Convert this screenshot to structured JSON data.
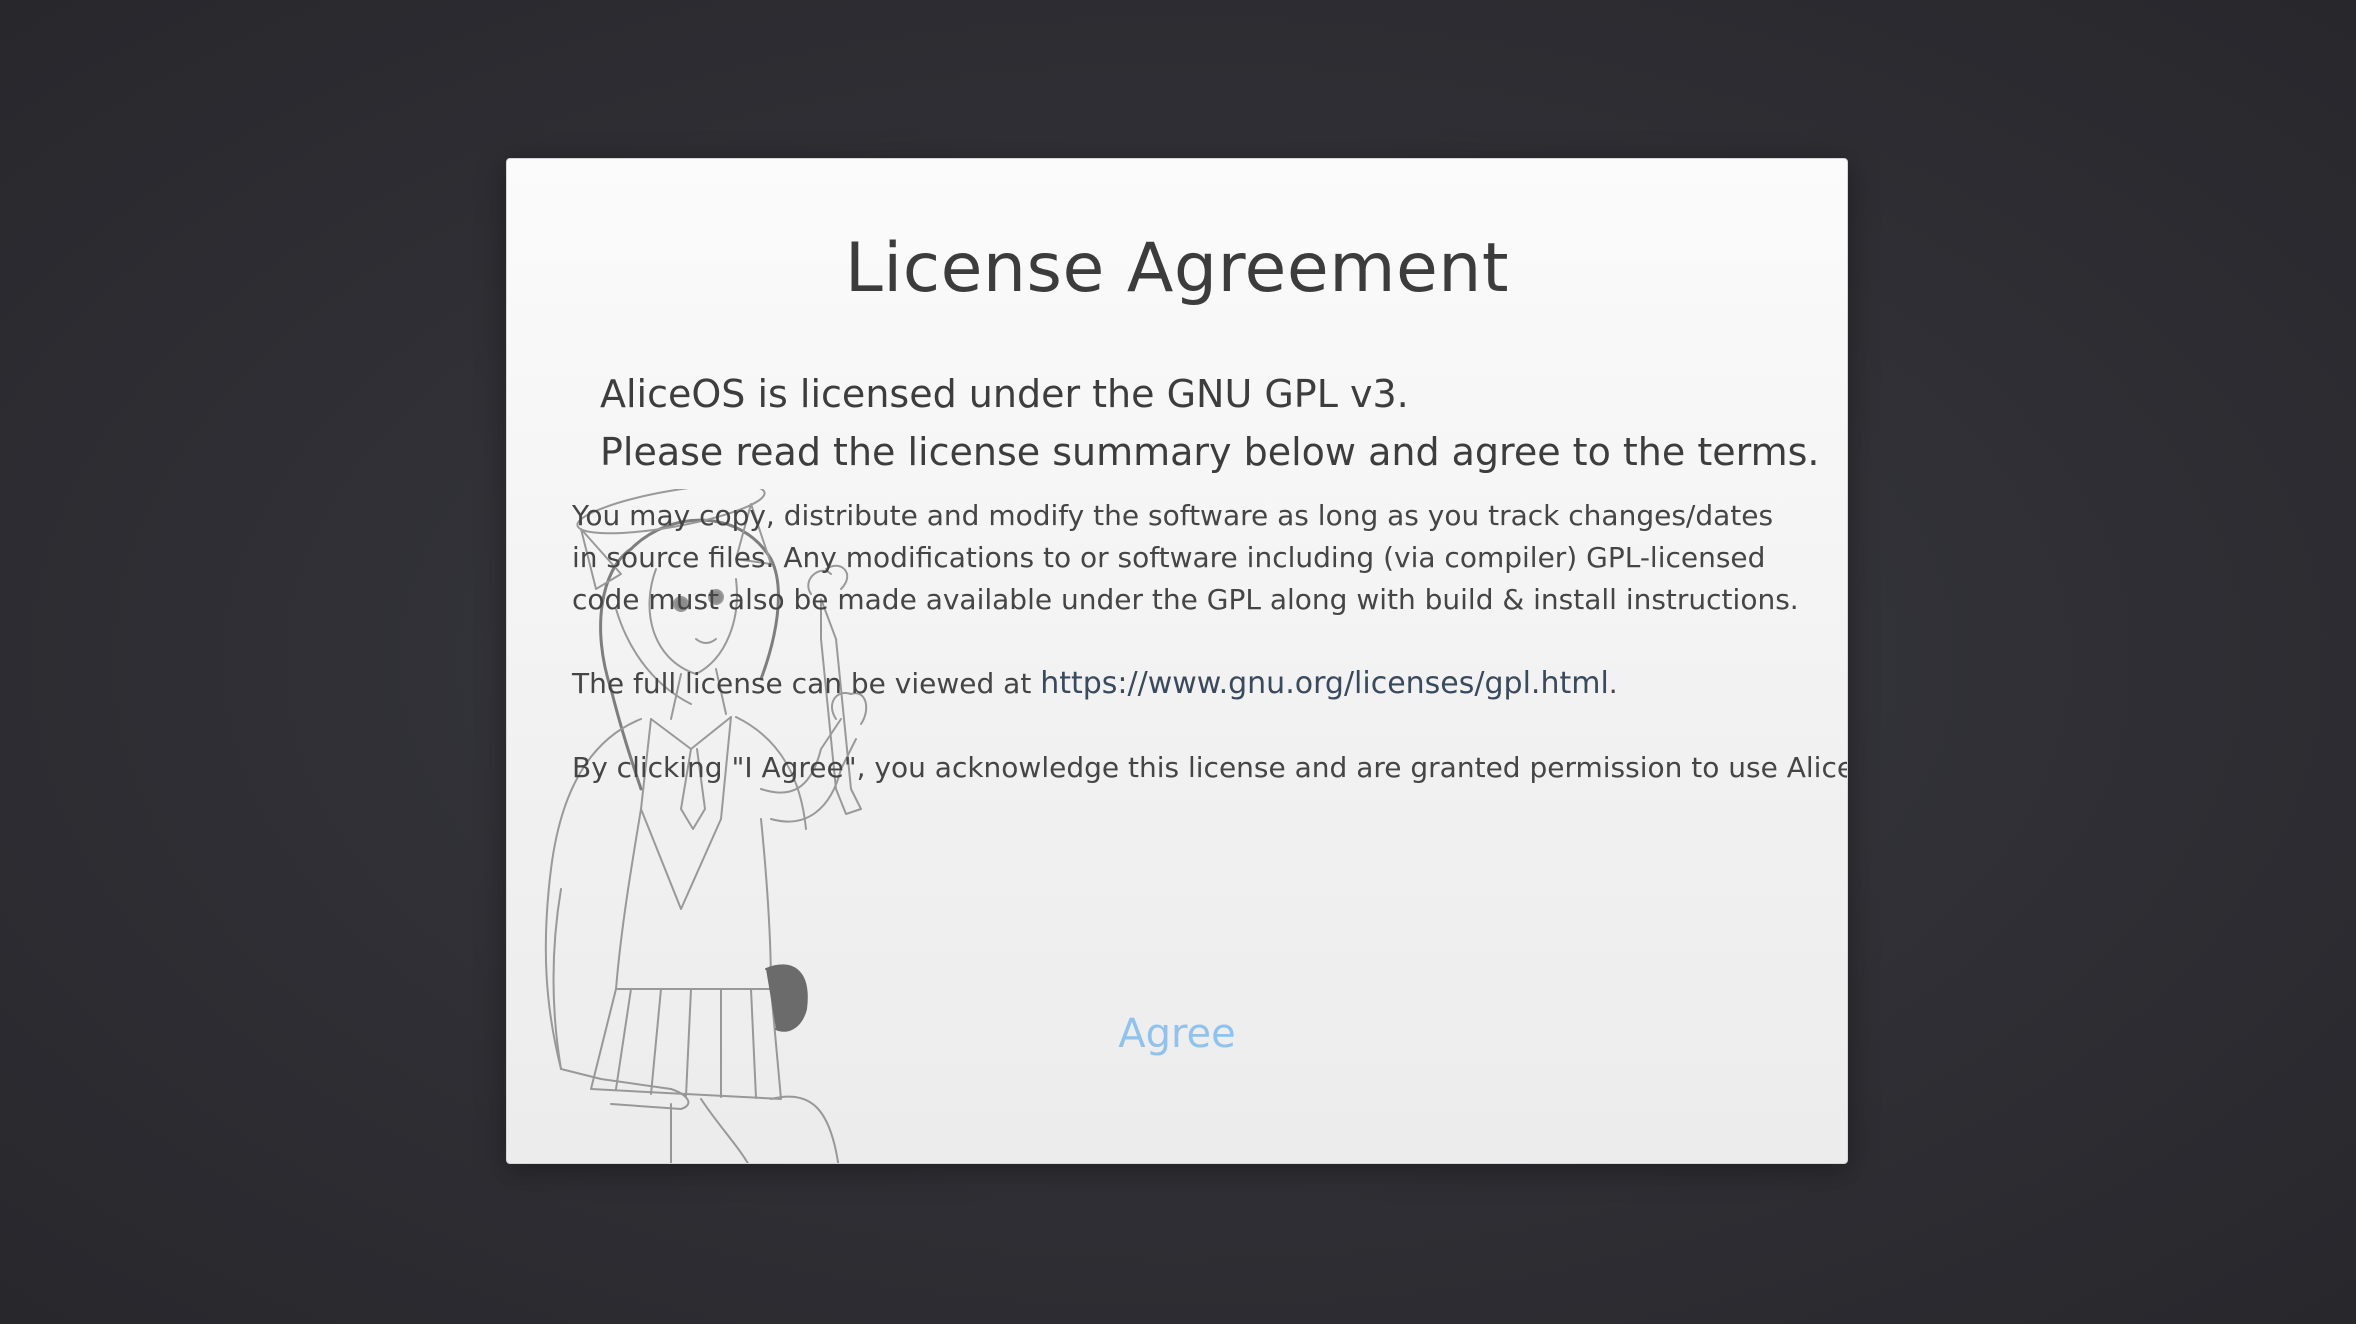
{
  "dialog": {
    "title": "License Agreement",
    "intro_line1": "AliceOS is licensed under the GNU GPL v3.",
    "intro_line2": "Please read the license summary below and agree to the terms.",
    "summary_line1": "You may copy, distribute and modify the software as long as you track changes/dates",
    "summary_line2": "in source files. Any modifications to or software including (via compiler) GPL-licensed",
    "summary_line3": "code must also be made available under the GPL along with build & install instructions.",
    "full_license_prefix": "The full license can be viewed at ",
    "full_license_link": "https://www.gnu.org/licenses/gpl.html",
    "full_license_suffix": ".",
    "acknowledge": "By clicking \"I Agree\", you acknowledge this license and are granted permission to use AliceOS.",
    "agree_button": "Agree",
    "mascot_icon": "mascot-sketch-illustration"
  },
  "colors": {
    "background": "#2f2f35",
    "dialog": "#f4f4f4",
    "title_text": "#3c3c3c",
    "link": "#3a4a5e",
    "agree_button": "#8fc3ee"
  }
}
